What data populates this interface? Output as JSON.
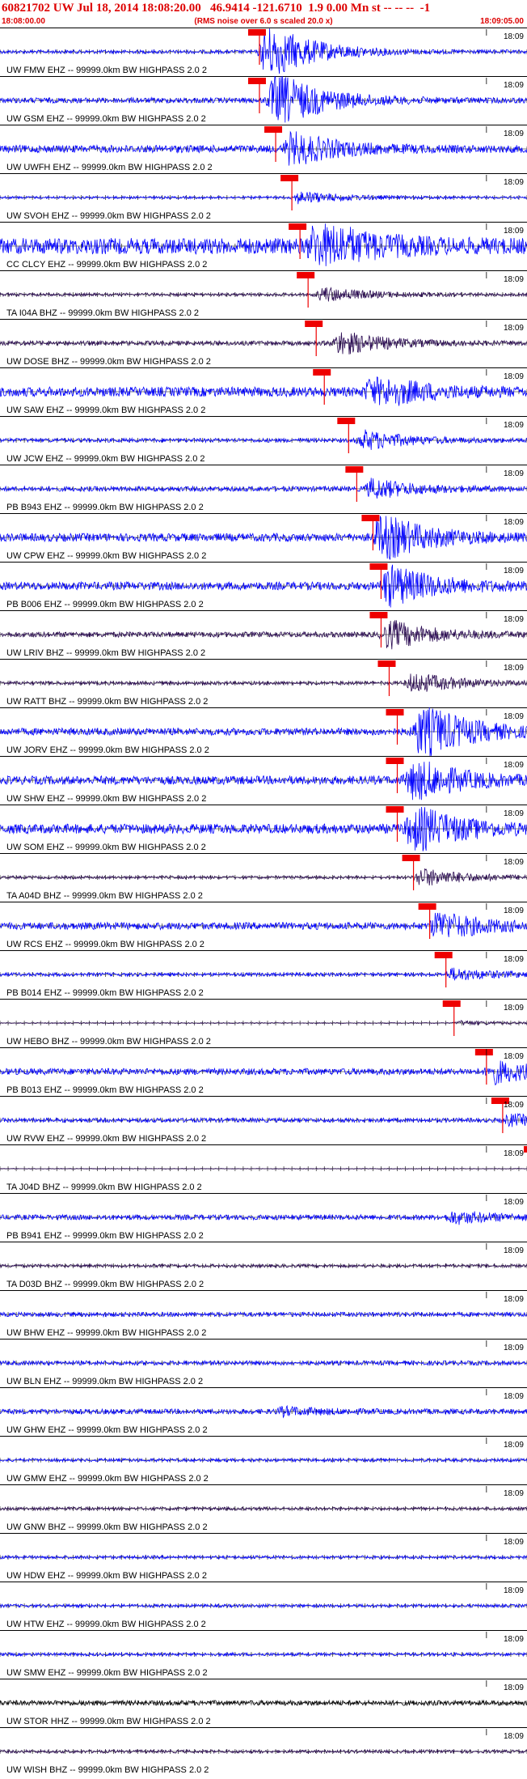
{
  "header": {
    "title": "60821702 UW Jul 18, 2014 18:08:20.00   46.9414 -121.6710  1.9 0.00 Mn st -- -- --  -1",
    "start_time": "18:08:00.00",
    "rms_note": "(RMS noise over 6.0 s scaled 20.0 x)",
    "end_time": "18:09:05.00"
  },
  "colors": {
    "trace_blue": "#0000ff",
    "trace_dark": "#2a0a52",
    "pick_red": "#ee0000",
    "header_red": "#dd0000"
  },
  "chart_data": {
    "type": "line",
    "title": "60821702 UW Jul 18, 2014 18:08:20.00   46.9414 -121.6710  1.9 0.00 Mn st -- -- --  -1",
    "xlabel": "",
    "ylabel": "",
    "xlim": [
      "18:08:00.00",
      "18:09:05.00"
    ],
    "x_tick_label": "18:09",
    "grid": false,
    "series": [
      {
        "name": "UW FMW EHZ -- 99999.0km BW  HIGHPASS  2.0  2",
        "color": "blue",
        "pick": "18:08:32",
        "peak": "18:08:33",
        "amp": 1.0,
        "burst": 1.0,
        "noise": 0.1
      },
      {
        "name": "UW GSM EHZ -- 99999.0km BW  HIGHPASS  2.0  2",
        "color": "blue",
        "pick": "18:08:32",
        "peak": "18:08:34",
        "amp": 1.0,
        "burst": 1.0,
        "noise": 0.15
      },
      {
        "name": "UW UWFH EHZ -- 99999.0km BW  HIGHPASS  2.0  2",
        "color": "blue",
        "pick": "18:08:34",
        "peak": "18:08:36",
        "amp": 0.7,
        "burst": 0.8,
        "noise": 0.3
      },
      {
        "name": "UW SVOH EHZ -- 99999.0km BW  HIGHPASS  2.0  2",
        "color": "blue",
        "pick": "18:08:36",
        "peak": "18:08:37",
        "amp": 0.7,
        "burst": 0.3,
        "noise": 0.1
      },
      {
        "name": "CC CLCY EHZ -- 99999.0km BW  HIGHPASS  2.0  2",
        "color": "blue",
        "pick": "18:08:37",
        "peak": "18:08:39",
        "amp": 0.9,
        "burst": 1.0,
        "noise": 0.5
      },
      {
        "name": "TA I04A BHZ -- 99999.0km BW  HIGHPASS  2.0  2",
        "color": "dark",
        "pick": "18:08:38",
        "peak": "18:08:40",
        "amp": 0.35,
        "burst": 0.7,
        "noise": 0.25
      },
      {
        "name": "UW DOSE BHZ -- 99999.0km BW  HIGHPASS  2.0  2",
        "color": "dark",
        "pick": "18:08:39",
        "peak": "18:08:42",
        "amp": 0.5,
        "burst": 0.8,
        "noise": 0.25
      },
      {
        "name": "UW SAW EHZ -- 99999.0km BW  HIGHPASS  2.0  2",
        "color": "blue",
        "pick": "18:08:40",
        "peak": "18:08:46",
        "amp": 0.6,
        "burst": 1.0,
        "noise": 0.45
      },
      {
        "name": "UW JCW EHZ -- 99999.0km BW  HIGHPASS  2.0  2",
        "color": "blue",
        "pick": "18:08:43",
        "peak": "18:08:45",
        "amp": 0.55,
        "burst": 0.6,
        "noise": 0.2
      },
      {
        "name": "PB B943 EHZ -- 99999.0km BW  HIGHPASS  2.0  2",
        "color": "blue",
        "pick": "18:08:44",
        "peak": "18:08:46",
        "amp": 0.55,
        "burst": 0.6,
        "noise": 0.25
      },
      {
        "name": "UW CPW EHZ -- 99999.0km BW  HIGHPASS  2.0  2",
        "color": "blue",
        "pick": "18:08:46",
        "peak": "18:08:47",
        "amp": 0.9,
        "burst": 0.9,
        "noise": 0.25
      },
      {
        "name": "PB B006 EHZ -- 99999.0km BW  HIGHPASS  2.0  2",
        "color": "blue",
        "pick": "18:08:47",
        "peak": "18:08:48",
        "amp": 0.9,
        "burst": 0.8,
        "noise": 0.25
      },
      {
        "name": "UW LRIV BHZ -- 99999.0km BW  HIGHPASS  2.0  2",
        "color": "dark",
        "pick": "18:08:47",
        "peak": "18:08:48",
        "amp": 0.6,
        "burst": 0.8,
        "noise": 0.25
      },
      {
        "name": "UW RATT BHZ -- 99999.0km BW  HIGHPASS  2.0  2",
        "color": "dark",
        "pick": "18:08:48",
        "peak": "18:08:51",
        "amp": 0.4,
        "burst": 0.9,
        "noise": 0.25
      },
      {
        "name": "UW JORV EHZ -- 99999.0km BW  HIGHPASS  2.0  2",
        "color": "blue",
        "pick": "18:08:49",
        "peak": "18:08:52",
        "amp": 1.0,
        "burst": 1.0,
        "noise": 0.2
      },
      {
        "name": "UW SHW EHZ -- 99999.0km BW  HIGHPASS  2.0  2",
        "color": "blue",
        "pick": "18:08:49",
        "peak": "18:08:51",
        "amp": 0.8,
        "burst": 0.9,
        "noise": 0.3
      },
      {
        "name": "UW SOM EHZ -- 99999.0km BW  HIGHPASS  2.0  2",
        "color": "blue",
        "pick": "18:08:49",
        "peak": "18:08:51",
        "amp": 0.9,
        "burst": 0.9,
        "noise": 0.3
      },
      {
        "name": "TA A04D BHZ -- 99999.0km BW  HIGHPASS  2.0  2",
        "color": "dark",
        "pick": "18:08:51",
        "peak": "18:08:52",
        "amp": 0.4,
        "burst": 0.8,
        "noise": 0.2
      },
      {
        "name": "UW RCS EHZ -- 99999.0km BW  HIGHPASS  2.0  2",
        "color": "blue",
        "pick": "18:08:53",
        "peak": "18:08:54",
        "amp": 0.8,
        "burst": 0.6,
        "noise": 0.25
      },
      {
        "name": "PB B014 EHZ -- 99999.0km BW  HIGHPASS  2.0  2",
        "color": "blue",
        "pick": "18:08:55",
        "peak": "18:08:56",
        "amp": 0.4,
        "burst": 0.5,
        "noise": 0.25
      },
      {
        "name": "UW HEBO BHZ -- 99999.0km BW  HIGHPASS  2.0  2",
        "color": "dark",
        "pick": "18:08:56",
        "peak": "18:08:57",
        "amp": 0.2,
        "burst": 0.4,
        "noise": 0.15
      },
      {
        "name": "PB B013 EHZ -- 99999.0km BW  HIGHPASS  2.0  2",
        "color": "blue",
        "pick": "18:09:00",
        "peak": "18:09:01",
        "amp": 0.6,
        "burst": 0.6,
        "noise": 0.3
      },
      {
        "name": "UW RVW EHZ -- 99999.0km BW  HIGHPASS  2.0  2",
        "color": "blue",
        "pick": "18:09:02",
        "peak": "18:09:03",
        "amp": 0.6,
        "burst": 0.3,
        "noise": 0.2
      },
      {
        "name": "TA J04D BHZ -- 99999.0km BW  HIGHPASS  2.0  2",
        "color": "dark",
        "pick": "18:09:06",
        "peak": "18:09:07",
        "amp": 0.2,
        "burst": 0.2,
        "noise": 0.1
      },
      {
        "name": "PB B941 EHZ -- 99999.0km BW  HIGHPASS  2.0  2",
        "color": "blue",
        "pick": null,
        "peak": "18:08:56",
        "amp": 0.4,
        "burst": 0.5,
        "noise": 0.35
      },
      {
        "name": "TA D03D BHZ -- 99999.0km BW  HIGHPASS  2.0  2",
        "color": "dark",
        "pick": null,
        "peak": null,
        "amp": 0.3,
        "burst": 0,
        "noise": 0.3
      },
      {
        "name": "UW BHW EHZ -- 99999.0km BW  HIGHPASS  2.0  2",
        "color": "blue",
        "pick": null,
        "peak": null,
        "amp": 0.35,
        "burst": 0,
        "noise": 0.35
      },
      {
        "name": "UW BLN EHZ -- 99999.0km BW  HIGHPASS  2.0  2",
        "color": "blue",
        "pick": null,
        "peak": null,
        "amp": 0.35,
        "burst": 0,
        "noise": 0.35
      },
      {
        "name": "UW GHW EHZ -- 99999.0km BW  HIGHPASS  2.0  2",
        "color": "blue",
        "pick": null,
        "peak": "18:08:35",
        "amp": 0.4,
        "burst": 0.3,
        "noise": 0.35
      },
      {
        "name": "UW GMW EHZ -- 99999.0km BW  HIGHPASS  2.0  2",
        "color": "blue",
        "pick": null,
        "peak": null,
        "amp": 0.3,
        "burst": 0,
        "noise": 0.3
      },
      {
        "name": "UW GNW BHZ -- 99999.0km BW  HIGHPASS  2.0  2",
        "color": "dark",
        "pick": null,
        "peak": null,
        "amp": 0.3,
        "burst": 0,
        "noise": 0.3
      },
      {
        "name": "UW HDW EHZ -- 99999.0km BW  HIGHPASS  2.0  2",
        "color": "blue",
        "pick": null,
        "peak": null,
        "amp": 0.3,
        "burst": 0,
        "noise": 0.3
      },
      {
        "name": "UW HTW EHZ -- 99999.0km BW  HIGHPASS  2.0  2",
        "color": "blue",
        "pick": null,
        "peak": null,
        "amp": 0.3,
        "burst": 0,
        "noise": 0.3
      },
      {
        "name": "UW SMW EHZ -- 99999.0km BW  HIGHPASS  2.0  2",
        "color": "blue",
        "pick": null,
        "peak": null,
        "amp": 0.3,
        "burst": 0,
        "noise": 0.3
      },
      {
        "name": "UW STOR HHZ -- 99999.0km BW  HIGHPASS  2.0  2",
        "color": "black",
        "pick": null,
        "peak": null,
        "amp": 0.35,
        "burst": 0,
        "noise": 0.4
      },
      {
        "name": "UW WISH BHZ -- 99999.0km BW  HIGHPASS  2.0  2",
        "color": "dark",
        "pick": null,
        "peak": null,
        "amp": 0.3,
        "burst": 0,
        "noise": 0.3
      }
    ]
  }
}
